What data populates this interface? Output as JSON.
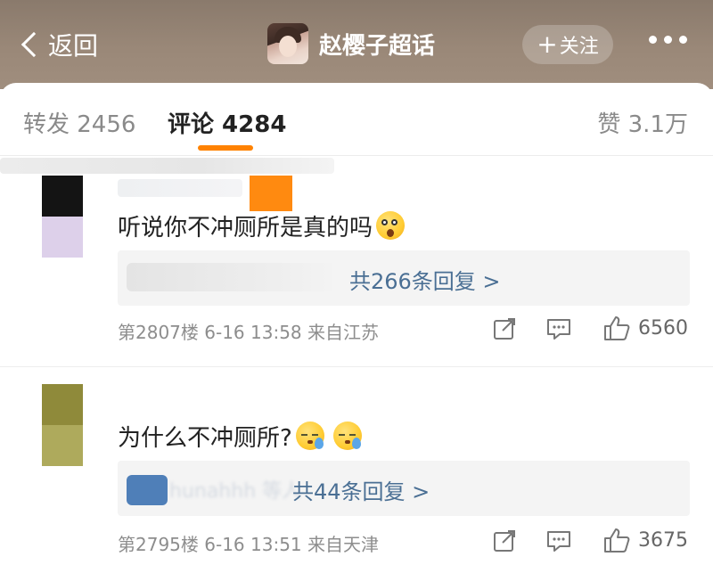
{
  "header": {
    "back_label": "返回",
    "topic_name": "赵樱子超话",
    "follow_label": "关注",
    "follow_prefix": "+"
  },
  "tabs": {
    "repost": "转发 2456",
    "comment": "评论 4284",
    "like": "赞 3.1万"
  },
  "comments": [
    {
      "text": "听说你不冲厕所是真的吗",
      "emoji": "astonished-emoji",
      "reply_link": "共266条回复 >",
      "meta": "第2807楼  6-16 13:58  来自江苏",
      "likes": "6560",
      "avatar_colors": [
        "#1a1a1a",
        "#ddd0ea"
      ]
    },
    {
      "text": "为什么不冲厕所?",
      "emoji": "sleepy-sweat-emoji",
      "reply_link": "共44条回复 >",
      "reply_user_blur": "hunahhh 等人",
      "meta": "第2795楼  6-16 13:51  来自天津",
      "likes": "3675",
      "avatar_colors": [
        "#8f8a3a",
        "#aeaa5c"
      ]
    }
  ],
  "colors": {
    "accent": "#ff8200",
    "link": "#4a6f94",
    "header_bg": "#9a8878"
  }
}
